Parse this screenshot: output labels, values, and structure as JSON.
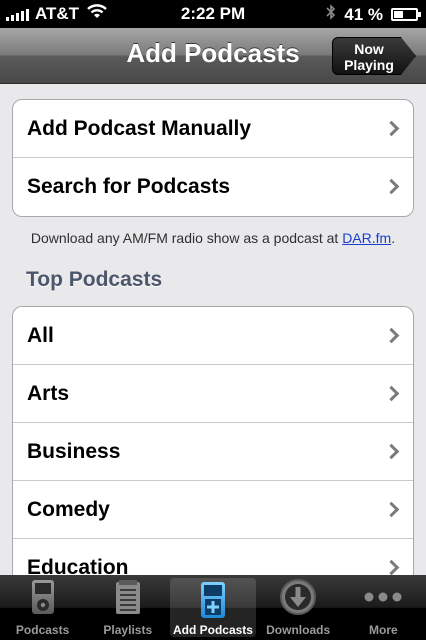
{
  "status_bar": {
    "carrier": "AT&T",
    "time": "2:22 PM",
    "battery_text": "41 %",
    "battery_level": 0.41
  },
  "nav": {
    "title": "Add Podcasts",
    "now_playing_line1": "Now",
    "now_playing_line2": "Playing"
  },
  "actions": [
    {
      "label": "Add Podcast Manually"
    },
    {
      "label": "Search for Podcasts"
    }
  ],
  "info": {
    "text": "Download any AM/FM radio show as a podcast at ",
    "link": "DAR.fm",
    "suffix": "."
  },
  "section_header": "Top Podcasts",
  "categories": [
    {
      "label": "All"
    },
    {
      "label": "Arts"
    },
    {
      "label": "Business"
    },
    {
      "label": "Comedy"
    },
    {
      "label": "Education"
    }
  ],
  "tabs": [
    {
      "label": "Podcasts",
      "icon": "ipod-icon",
      "active": false
    },
    {
      "label": "Playlists",
      "icon": "notepad-icon",
      "active": false
    },
    {
      "label": "Add Podcasts",
      "icon": "ipod-add-icon",
      "active": true
    },
    {
      "label": "Downloads",
      "icon": "download-arrow-icon",
      "active": false
    },
    {
      "label": "More",
      "icon": "more-dots-icon",
      "active": false
    }
  ],
  "colors": {
    "link": "#1a3dd0",
    "section_header": "#4c566c",
    "active_tab_icon": "#3aa2e8"
  }
}
